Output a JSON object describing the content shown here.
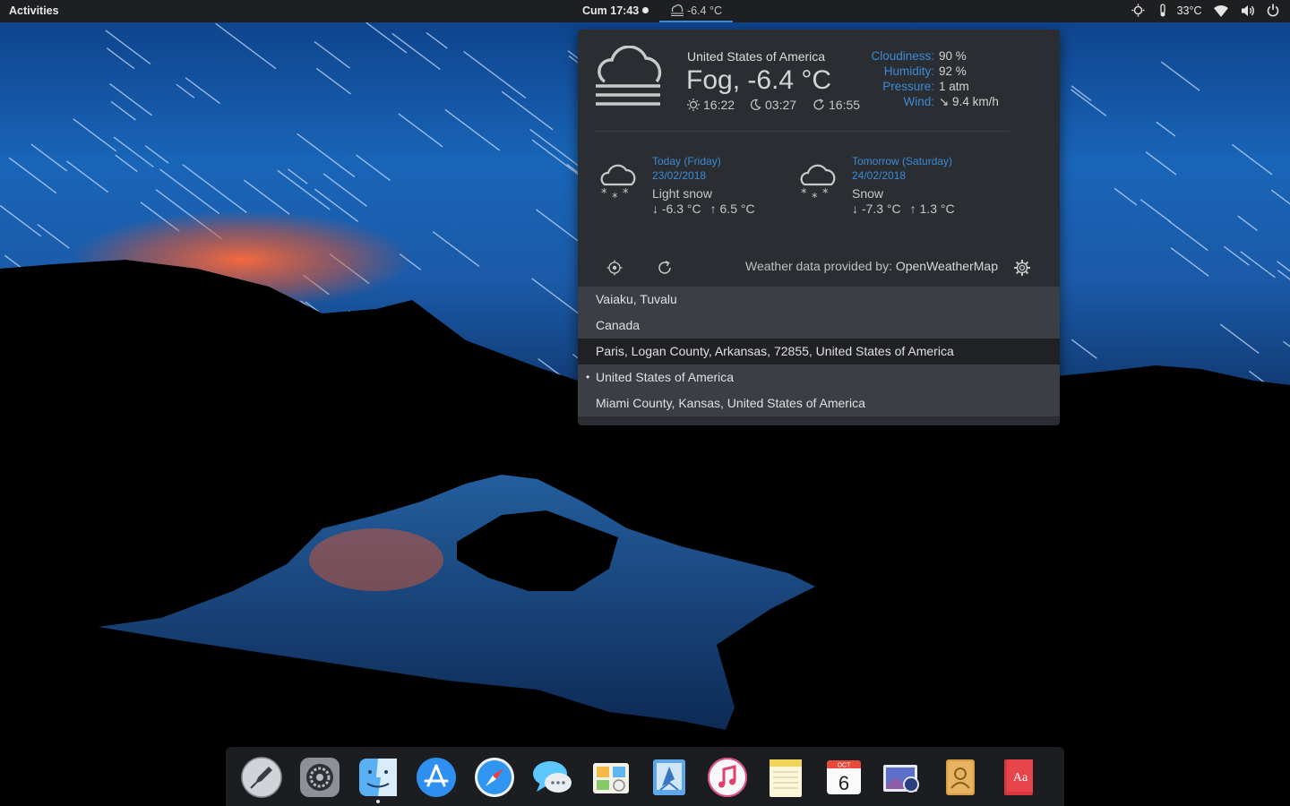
{
  "topbar": {
    "activities": "Activities",
    "clock": "Cum 17:43",
    "weather_temp": "-6.4 °C",
    "cpu_temp": "33°C",
    "accent": "#3d8bd6"
  },
  "current": {
    "location": "United States of America",
    "summary": "Fog, -6.4 °C",
    "sunrise": "16:22",
    "sunset": "03:27",
    "last_updated": "16:55",
    "icon": "fog-cloud-icon",
    "details": [
      {
        "label": "Cloudiness:",
        "value": "90 %"
      },
      {
        "label": "Humidity:",
        "value": "92 %"
      },
      {
        "label": "Pressure:",
        "value": "1 atm"
      },
      {
        "label": "Wind:",
        "value": "↘ 9.4 km/h"
      }
    ]
  },
  "forecast": [
    {
      "day": "Today (Friday)",
      "date": "23/02/2018",
      "condition": "Light snow",
      "low": "↓ -6.3 °C",
      "high": "↑ 6.5 °C",
      "icon": "snow-cloud-icon"
    },
    {
      "day": "Tomorrow (Saturday)",
      "date": "24/02/2018",
      "condition": "Snow",
      "low": "↓ -7.3 °C",
      "high": "↑ 1.3 °C",
      "icon": "snow-cloud-icon"
    }
  ],
  "footer": {
    "provider_label": "Weather data provided by:",
    "provider_name": "OpenWeatherMap"
  },
  "locations": [
    {
      "name": "Vaiaku, Tuvalu",
      "active": false,
      "hovered": false
    },
    {
      "name": "Canada",
      "active": false,
      "hovered": false
    },
    {
      "name": "Paris, Logan County, Arkansas, 72855, United States of America",
      "active": false,
      "hovered": true
    },
    {
      "name": "United States of America",
      "active": true,
      "hovered": false,
      "bullet": "•"
    },
    {
      "name": "Miami County, Kansas, United States of America",
      "active": false,
      "hovered": false
    }
  ],
  "dock": [
    "launchpad-icon",
    "system-preferences-icon",
    "finder-icon",
    "app-store-icon",
    "safari-icon",
    "messages-icon",
    "photos-icon",
    "mail-icon",
    "itunes-icon",
    "notes-icon",
    "calendar-icon",
    "preview-icon",
    "contacts-icon",
    "dictionary-icon"
  ],
  "calendar_icon": {
    "month": "OCT",
    "day": "6"
  },
  "dictionary_icon": {
    "text": "Aa"
  }
}
